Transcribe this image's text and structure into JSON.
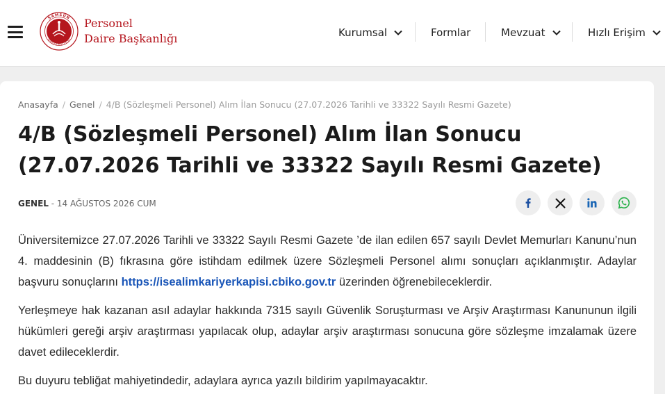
{
  "header": {
    "logo": {
      "ring_text": "SAMSUN ÜNİVERSİTESİ",
      "line1": "Personel",
      "line2": "Daire Başkanlığı"
    },
    "nav": [
      {
        "label": "Kurumsal",
        "dropdown": true
      },
      {
        "label": "Formlar",
        "dropdown": false
      },
      {
        "label": "Mevzuat",
        "dropdown": true
      },
      {
        "label": "Hızlı Erişim",
        "dropdown": true
      }
    ]
  },
  "breadcrumb": {
    "home": "Anasayfa",
    "category": "Genel",
    "current": "4/B (Sözleşmeli Personel) Alım İlan Sonucu (27.07.2026 Tarihli ve 33322 Sayılı Resmi Gazete)"
  },
  "article": {
    "title": "4/B (Sözleşmeli Personel) Alım İlan Sonucu (27.07.2026 Tarihli ve 33322 Sayılı Resmi Gazete)",
    "category": "GENEL",
    "date": "- 14 AĞUSTOS 2026 CUM",
    "p1_before": "Üniversitemizce 27.07.2026 Tarihli ve 33322 Sayılı Resmi Gazete ’de ilan edilen 657 sayılı Devlet Memurları Kanunu’nun 4. maddesinin (B) fıkrasına göre istihdam edilmek üzere Sözleşmeli Personel alımı sonuçları açıklanmıştır. Adaylar başvuru sonuçlarını ",
    "p1_link": "https://isealimkariyerkapisi.cbiko.gov.tr",
    "p1_after": " üzerinden öğrenebileceklerdir.",
    "p2": "Yerleşmeye hak kazanan asıl adaylar hakkında 7315 sayılı Güvenlik Soruşturması ve Arşiv Araştırması Kanununun ilgili hükümleri gereği arşiv araştırması yapılacak olup, adaylar arşiv araştırması sonucuna göre sözleşme imzalamak üzere davet edileceklerdir.",
    "p3": "Bu duyuru tebliğat mahiyetindedir, adaylara ayrıca yazılı bildirim yapılmayacaktır."
  },
  "share": [
    {
      "icon": "facebook-icon",
      "color": "#1a4fa0"
    },
    {
      "icon": "x-icon",
      "color": "#111111"
    },
    {
      "icon": "linkedin-icon",
      "color": "#1a66b5"
    },
    {
      "icon": "whatsapp-icon",
      "color": "#2bb24c"
    }
  ],
  "colors": {
    "brand": "#b5161e",
    "link": "#1a56b8",
    "background": "#efefef"
  }
}
